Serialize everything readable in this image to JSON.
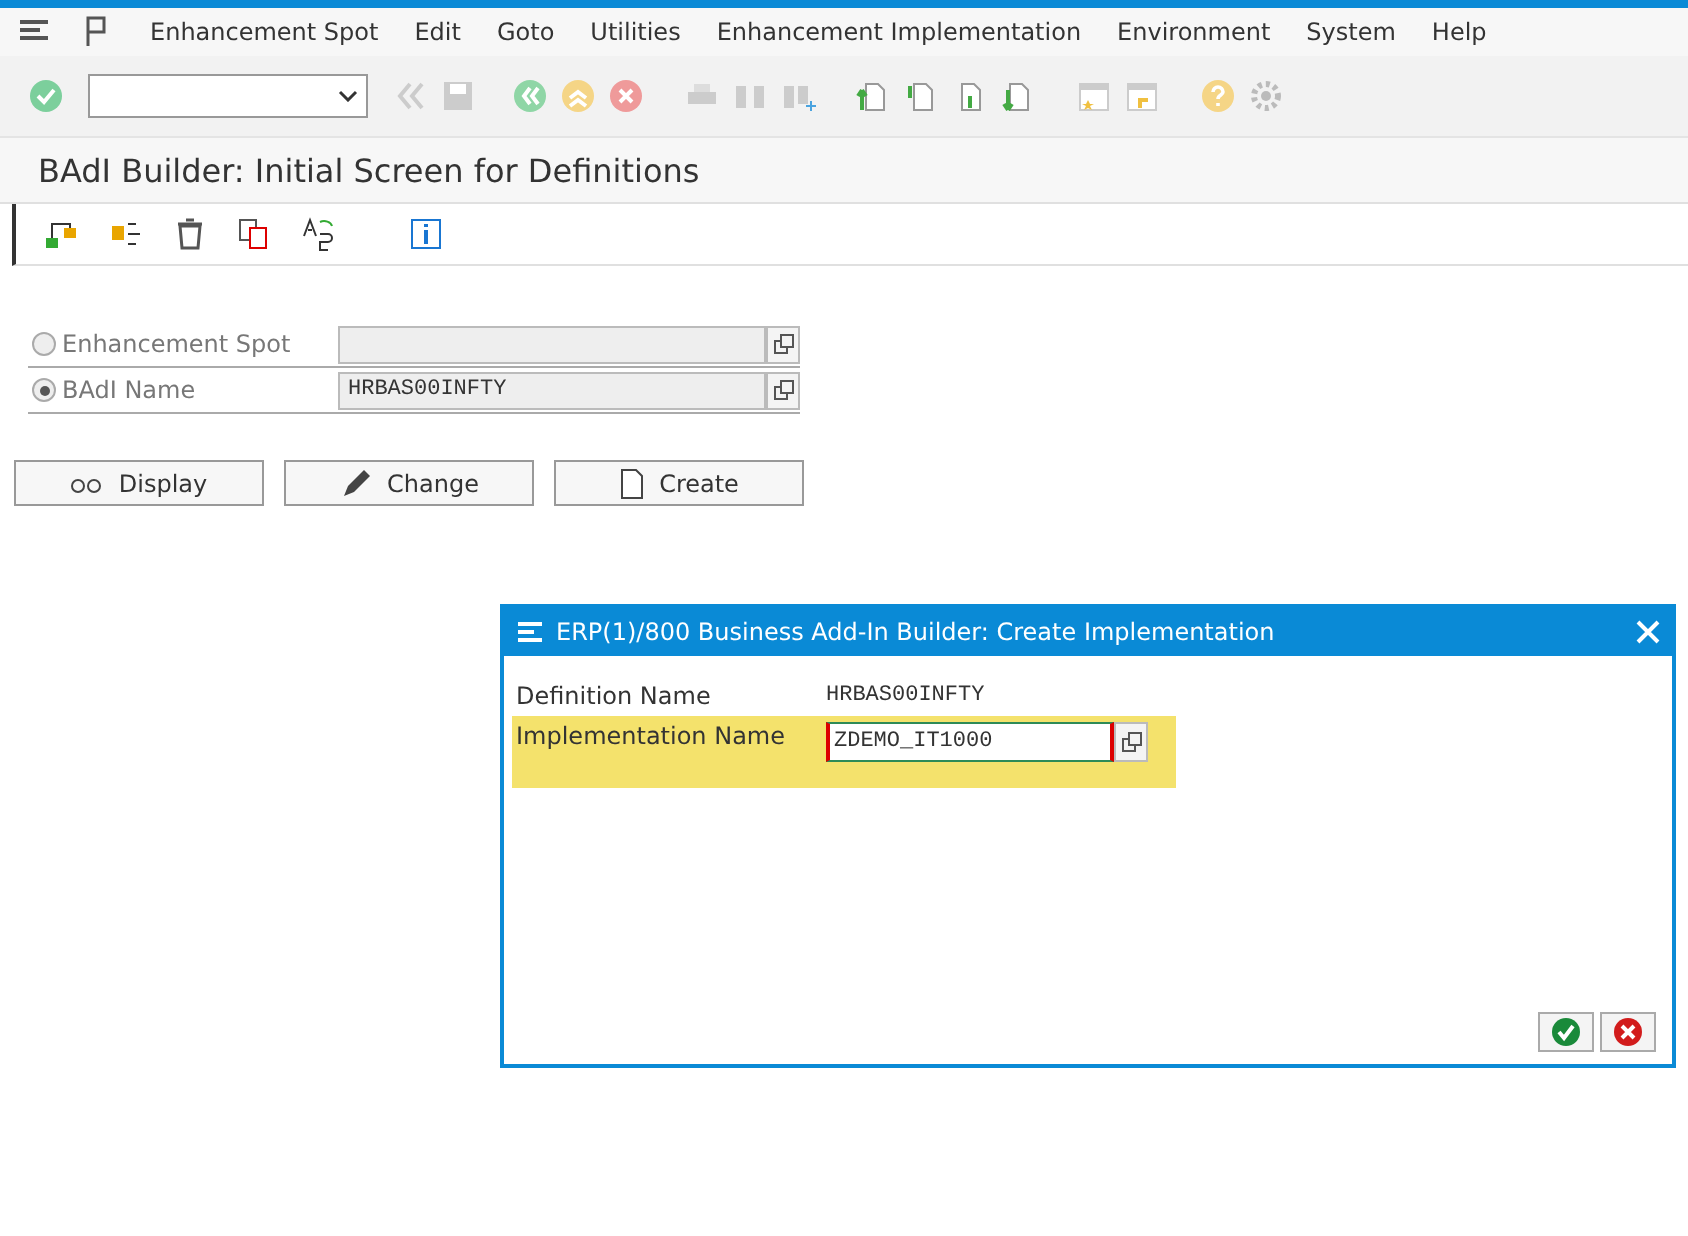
{
  "menu_bar": {
    "items": [
      "Enhancement Spot",
      "Edit",
      "Goto",
      "Utilities",
      "Enhancement Implementation",
      "Environment",
      "System",
      "Help"
    ]
  },
  "title": "BAdI Builder: Initial Screen for Definitions",
  "form": {
    "options": [
      {
        "label": "Enhancement Spot",
        "selected": false
      },
      {
        "label": "BAdI Name",
        "selected": true,
        "value": "HRBAS00INFTY"
      }
    ]
  },
  "buttons": [
    {
      "kind": "display",
      "label": "Display"
    },
    {
      "kind": "change",
      "label": "Change"
    },
    {
      "kind": "create",
      "label": "Create"
    }
  ],
  "dialog": {
    "title": "ERP(1)/800 Business Add-In Builder: Create Implementation",
    "fields": [
      {
        "label": "Definition Name",
        "value": "HRBAS00INFTY",
        "kind": "text"
      },
      {
        "label": "Implementation Name",
        "value": "ZDEMO_IT1000",
        "kind": "input"
      }
    ]
  }
}
